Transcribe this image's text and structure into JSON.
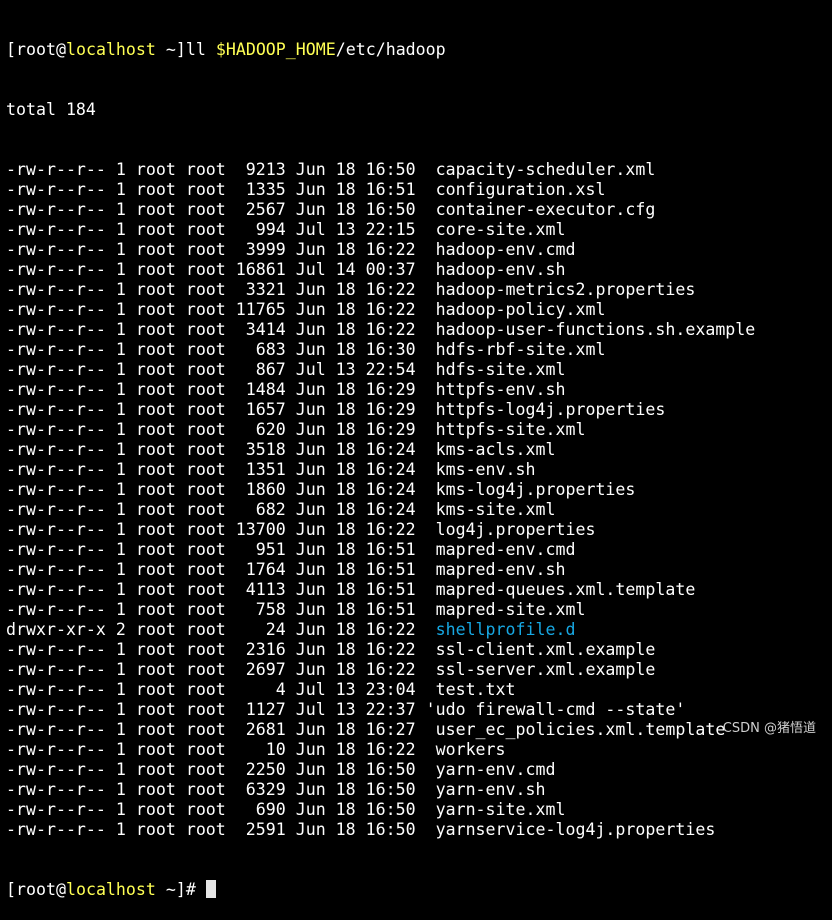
{
  "prompt": {
    "open_bracket": "[",
    "user": "root",
    "at": "@",
    "host": "localhost",
    "cwd": " ~",
    "close_bracket": "]",
    "symbol": "#"
  },
  "command": {
    "name": "ll ",
    "variable": "$HADOOP_HOME",
    "path": "/etc/hadoop"
  },
  "total_line": "total 184",
  "colors": {
    "background": "#000000",
    "text": "#ffffff",
    "hostname": "#ffff54",
    "directory": "#17a8e3"
  },
  "files": [
    {
      "meta": "-rw-r--r-- 1 root root  9213 Jun 18 16:50  ",
      "name": "capacity-scheduler.xml",
      "type": "file"
    },
    {
      "meta": "-rw-r--r-- 1 root root  1335 Jun 18 16:51  ",
      "name": "configuration.xsl",
      "type": "file"
    },
    {
      "meta": "-rw-r--r-- 1 root root  2567 Jun 18 16:50  ",
      "name": "container-executor.cfg",
      "type": "file"
    },
    {
      "meta": "-rw-r--r-- 1 root root   994 Jul 13 22:15  ",
      "name": "core-site.xml",
      "type": "file"
    },
    {
      "meta": "-rw-r--r-- 1 root root  3999 Jun 18 16:22  ",
      "name": "hadoop-env.cmd",
      "type": "file"
    },
    {
      "meta": "-rw-r--r-- 1 root root 16861 Jul 14 00:37  ",
      "name": "hadoop-env.sh",
      "type": "file"
    },
    {
      "meta": "-rw-r--r-- 1 root root  3321 Jun 18 16:22  ",
      "name": "hadoop-metrics2.properties",
      "type": "file"
    },
    {
      "meta": "-rw-r--r-- 1 root root 11765 Jun 18 16:22  ",
      "name": "hadoop-policy.xml",
      "type": "file"
    },
    {
      "meta": "-rw-r--r-- 1 root root  3414 Jun 18 16:22  ",
      "name": "hadoop-user-functions.sh.example",
      "type": "file"
    },
    {
      "meta": "-rw-r--r-- 1 root root   683 Jun 18 16:30  ",
      "name": "hdfs-rbf-site.xml",
      "type": "file"
    },
    {
      "meta": "-rw-r--r-- 1 root root   867 Jul 13 22:54  ",
      "name": "hdfs-site.xml",
      "type": "file"
    },
    {
      "meta": "-rw-r--r-- 1 root root  1484 Jun 18 16:29  ",
      "name": "httpfs-env.sh",
      "type": "file"
    },
    {
      "meta": "-rw-r--r-- 1 root root  1657 Jun 18 16:29  ",
      "name": "httpfs-log4j.properties",
      "type": "file"
    },
    {
      "meta": "-rw-r--r-- 1 root root   620 Jun 18 16:29  ",
      "name": "httpfs-site.xml",
      "type": "file"
    },
    {
      "meta": "-rw-r--r-- 1 root root  3518 Jun 18 16:24  ",
      "name": "kms-acls.xml",
      "type": "file"
    },
    {
      "meta": "-rw-r--r-- 1 root root  1351 Jun 18 16:24  ",
      "name": "kms-env.sh",
      "type": "file"
    },
    {
      "meta": "-rw-r--r-- 1 root root  1860 Jun 18 16:24  ",
      "name": "kms-log4j.properties",
      "type": "file"
    },
    {
      "meta": "-rw-r--r-- 1 root root   682 Jun 18 16:24  ",
      "name": "kms-site.xml",
      "type": "file"
    },
    {
      "meta": "-rw-r--r-- 1 root root 13700 Jun 18 16:22  ",
      "name": "log4j.properties",
      "type": "file"
    },
    {
      "meta": "-rw-r--r-- 1 root root   951 Jun 18 16:51  ",
      "name": "mapred-env.cmd",
      "type": "file"
    },
    {
      "meta": "-rw-r--r-- 1 root root  1764 Jun 18 16:51  ",
      "name": "mapred-env.sh",
      "type": "file"
    },
    {
      "meta": "-rw-r--r-- 1 root root  4113 Jun 18 16:51  ",
      "name": "mapred-queues.xml.template",
      "type": "file"
    },
    {
      "meta": "-rw-r--r-- 1 root root   758 Jun 18 16:51  ",
      "name": "mapred-site.xml",
      "type": "file"
    },
    {
      "meta": "drwxr-xr-x 2 root root    24 Jun 18 16:22  ",
      "name": "shellprofile.d",
      "type": "dir"
    },
    {
      "meta": "-rw-r--r-- 1 root root  2316 Jun 18 16:22  ",
      "name": "ssl-client.xml.example",
      "type": "file"
    },
    {
      "meta": "-rw-r--r-- 1 root root  2697 Jun 18 16:22  ",
      "name": "ssl-server.xml.example",
      "type": "file"
    },
    {
      "meta": "-rw-r--r-- 1 root root     4 Jul 13 23:04  ",
      "name": "test.txt",
      "type": "file"
    },
    {
      "meta": "-rw-r--r-- 1 root root  1127 Jul 13 22:37 ",
      "name": "'udo firewall-cmd --state'",
      "type": "file"
    },
    {
      "meta": "-rw-r--r-- 1 root root  2681 Jun 18 16:27  ",
      "name": "user_ec_policies.xml.template",
      "type": "file"
    },
    {
      "meta": "-rw-r--r-- 1 root root    10 Jun 18 16:22  ",
      "name": "workers",
      "type": "file"
    },
    {
      "meta": "-rw-r--r-- 1 root root  2250 Jun 18 16:50  ",
      "name": "yarn-env.cmd",
      "type": "file"
    },
    {
      "meta": "-rw-r--r-- 1 root root  6329 Jun 18 16:50  ",
      "name": "yarn-env.sh",
      "type": "file"
    },
    {
      "meta": "-rw-r--r-- 1 root root   690 Jun 18 16:50  ",
      "name": "yarn-site.xml",
      "type": "file"
    },
    {
      "meta": "-rw-r--r-- 1 root root  2591 Jun 18 16:50  ",
      "name": "yarnservice-log4j.properties",
      "type": "file"
    }
  ],
  "watermark": "CSDN @猪悟道"
}
